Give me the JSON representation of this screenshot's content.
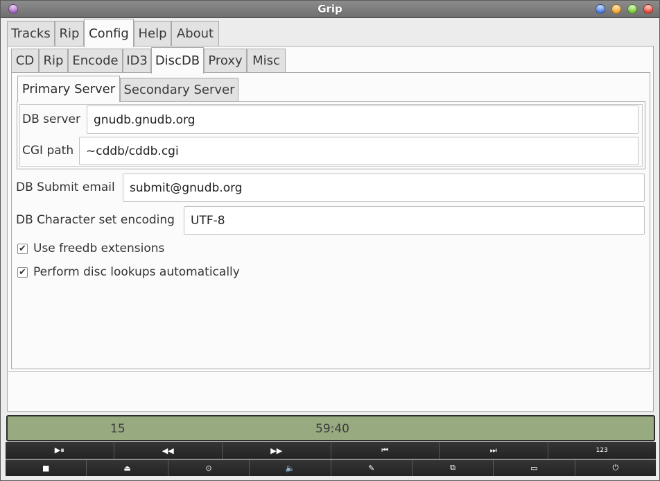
{
  "window": {
    "title": "Grip"
  },
  "main_tabs": [
    "Tracks",
    "Rip",
    "Config",
    "Help",
    "About"
  ],
  "config_tabs": [
    "CD",
    "Rip",
    "Encode",
    "ID3",
    "DiscDB",
    "Proxy",
    "Misc"
  ],
  "server_tabs": [
    "Primary Server",
    "Secondary Server"
  ],
  "discdb": {
    "db_server_label": "DB server",
    "db_server_value": "gnudb.gnudb.org",
    "cgi_path_label": "CGI path",
    "cgi_path_value": "~cddb/cddb.cgi",
    "submit_email_label": "DB Submit email",
    "submit_email_value": "submit@gnudb.org",
    "charset_label": "DB Character set encoding",
    "charset_value": "UTF-8",
    "freedb_ext_label": "Use freedb extensions",
    "freedb_ext_checked": true,
    "auto_lookup_label": "Perform disc lookups automatically",
    "auto_lookup_checked": true
  },
  "status": {
    "track": "15",
    "time": "59:40"
  },
  "controls_row1": [
    {
      "name": "play-pause-icon",
      "glyph": "▶⏸"
    },
    {
      "name": "rewind-icon",
      "glyph": "◀◀"
    },
    {
      "name": "fast-forward-icon",
      "glyph": "▶▶"
    },
    {
      "name": "previous-track-icon",
      "glyph": "⏮"
    },
    {
      "name": "next-track-icon",
      "glyph": "⏭"
    },
    {
      "name": "track-number-icon",
      "glyph": "123"
    }
  ],
  "controls_row2": [
    {
      "name": "stop-icon",
      "glyph": "■"
    },
    {
      "name": "eject-icon",
      "glyph": "⏏"
    },
    {
      "name": "disc-icon",
      "glyph": "⊙"
    },
    {
      "name": "volume-icon",
      "glyph": "🔈"
    },
    {
      "name": "edit-icon",
      "glyph": "✎"
    },
    {
      "name": "network-icon",
      "glyph": "⧉"
    },
    {
      "name": "window-icon",
      "glyph": "▭"
    },
    {
      "name": "power-icon",
      "glyph": "⏻"
    }
  ]
}
